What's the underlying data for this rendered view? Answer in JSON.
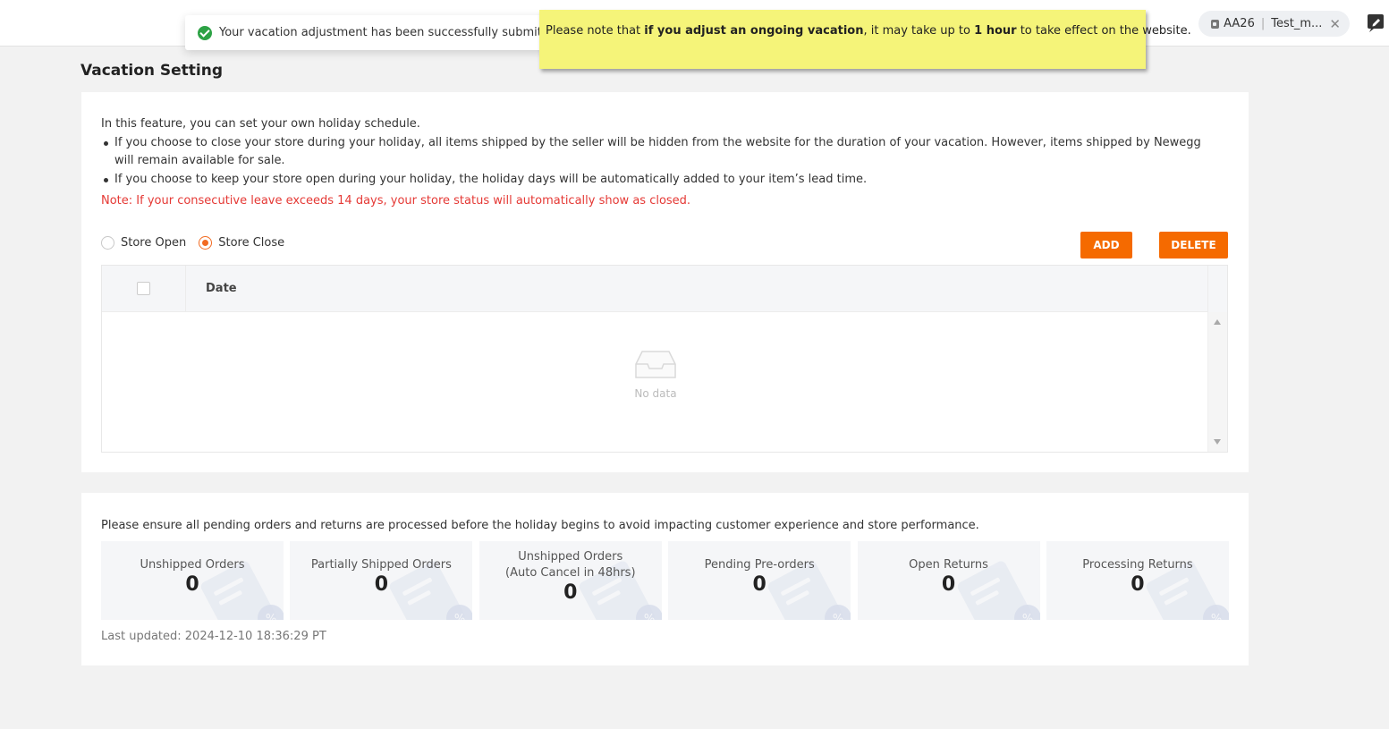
{
  "header": {
    "account_code": "AA26",
    "account_name": "Test_m..."
  },
  "toast": {
    "message": "Your vacation adjustment has been successfully submitted."
  },
  "sticky_note": {
    "part1": "Please note that ",
    "bold1": "if you adjust an ongoing vacation",
    "part2": ", it may take up to ",
    "bold2": "1 hour",
    "part3": " to take effect on the website."
  },
  "page": {
    "title": "Vacation Setting"
  },
  "vacation": {
    "intro": "In this feature, you can set your own holiday schedule.",
    "bullets": [
      "If you choose to close your store during your holiday, all items shipped by the seller will be hidden from the website for the duration of your vacation. However, items shipped by Newegg will remain available for sale.",
      "If you choose to keep your store open during your holiday, the holiday days will be automatically added to your item’s lead time."
    ],
    "note": "Note: If your consecutive leave exceeds 14 days, your store status will automatically show as closed.",
    "radio_open": "Store Open",
    "radio_close": "Store Close",
    "selected": "Store Close",
    "add_label": "ADD",
    "delete_label": "DELETE",
    "table": {
      "date_header": "Date",
      "empty_text": "No data"
    }
  },
  "pending": {
    "message": "Please ensure all pending orders and returns are processed before the holiday begins to avoid impacting customer experience and store performance.",
    "stats": [
      {
        "label": "Unshipped Orders",
        "sublabel": "",
        "value": "0"
      },
      {
        "label": "Partially Shipped Orders",
        "sublabel": "",
        "value": "0"
      },
      {
        "label": "Unshipped Orders",
        "sublabel": "(Auto Cancel in 48hrs)",
        "value": "0"
      },
      {
        "label": "Pending Pre-orders",
        "sublabel": "",
        "value": "0"
      },
      {
        "label": "Open Returns",
        "sublabel": "",
        "value": "0"
      },
      {
        "label": "Processing Returns",
        "sublabel": "",
        "value": "0"
      }
    ],
    "last_updated": "Last updated: 2024-12-10 18:36:29 PT"
  },
  "colors": {
    "accent": "#f56a00",
    "success": "#2da245",
    "note_red": "#e53935",
    "sticky_yellow": "#f5f479"
  }
}
